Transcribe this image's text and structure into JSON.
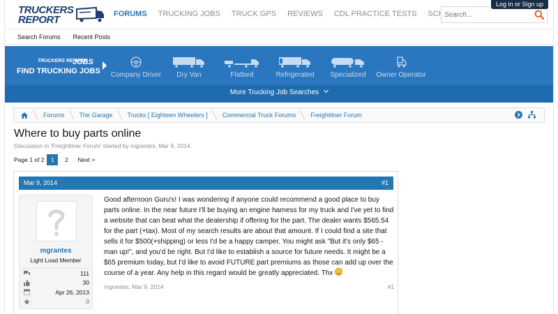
{
  "header": {
    "login_label": "Log in or Sign up",
    "logo_line1": "TRUCKERS",
    "logo_line2": "REPORT",
    "nav": [
      "FORUMS",
      "TRUCKING JOBS",
      "TRUCK GPS",
      "REVIEWS",
      "CDL PRACTICE TESTS",
      "SCHOOLS"
    ],
    "search_placeholder": "Search...",
    "subnav": [
      "Search Forums",
      "Recent Posts"
    ]
  },
  "jobs_band": {
    "brand_small": "TRUCKERS REPORT",
    "brand_jobs": "JOBS",
    "find_label": "FIND TRUCKING JOBS",
    "categories": [
      {
        "label": "Company Driver",
        "icon": "steering-wheel-icon"
      },
      {
        "label": "Dry Van",
        "icon": "dry-van-icon"
      },
      {
        "label": "Flatbed",
        "icon": "flatbed-icon"
      },
      {
        "label": "Refrigerated",
        "icon": "reefer-icon"
      },
      {
        "label": "Specialized",
        "icon": "tanker-icon"
      },
      {
        "label": "Owner Operator",
        "icon": "owner-operator-icon"
      }
    ],
    "more_label": "More Trucking Job Searches"
  },
  "breadcrumbs": [
    "Forums",
    "The Garage",
    "Trucks [ Eighteen Wheelers ]",
    "Commercial Truck Forums",
    "Freightliner Forum"
  ],
  "thread": {
    "title": "Where to buy parts online",
    "meta_prefix": "Discussion in '",
    "meta_forum": "Freightliner Forum",
    "meta_suffix": "' started by mgrantes, Mar 9, 2014.",
    "page_label": "Page 1 of 2",
    "pages": [
      "1",
      "2"
    ],
    "next_label": "Next >"
  },
  "post": {
    "date": "Mar 9, 2014",
    "number": "#1",
    "username": "mgrantes",
    "user_title": "Light Load Member",
    "stats": [
      {
        "icon": "messages-icon",
        "value": "111"
      },
      {
        "icon": "thumbs-up-icon",
        "value": "30"
      },
      {
        "icon": "calendar-icon",
        "value": "Apr 26, 2013"
      },
      {
        "icon": "star-icon",
        "value": "0"
      }
    ],
    "body": "Good afternoon Guru's! I was wondering if anyone could recommend a good place to buy parts online. In the near future I'll be buying an engine harness for my truck and I've yet to find a website that can beat what the dealership if offering for the part. The dealer wants $565.54 for the part (+tax). Most of my search results are about that amount. If I could find a site that sells it for $500(+shipping) or less I'd be a happy camper. You might ask \"But it's only $65 - man up!\", and you'd be right. But I'd like to establish a source for future needs. It might be a $65 premium today, but I'd like to avoid FUTURE part premiums as those can add up over the course of a year. Any help in this regard would be greatly appreciated. Thx",
    "footer_author": "mgrantes, Mar 9, 2014",
    "footer_number": "#1"
  },
  "colors": {
    "brand_blue": "#2577b1",
    "band_blue": "#1e6bb0",
    "logo_navy": "#1f3d6e",
    "search_orange": "#e0672a"
  }
}
